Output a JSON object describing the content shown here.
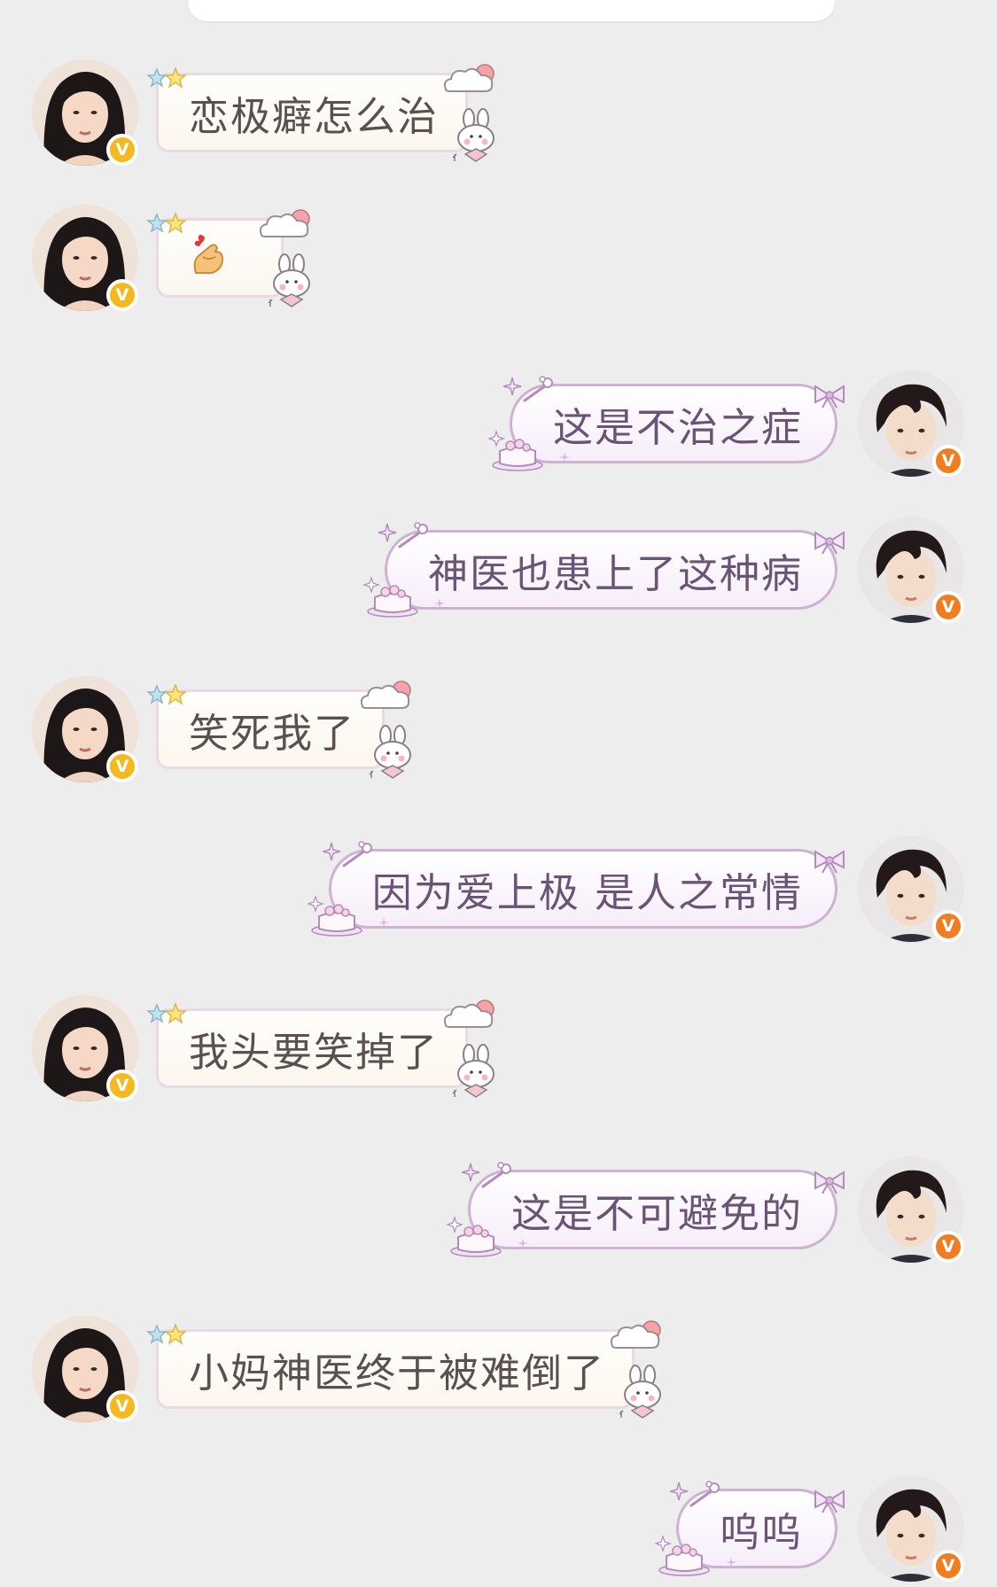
{
  "colors": {
    "background": "#ededed",
    "badge_left": "#f5b81f",
    "badge_right": "#f07e21",
    "bubble_left_border": "#ead9e6",
    "bubble_right_border": "#cfb1d4"
  },
  "icons": {
    "verified_badge": "V"
  },
  "messages": [
    {
      "side": "left",
      "text": "恋极癖怎么治"
    },
    {
      "side": "left",
      "text": "🫰",
      "emoji": true
    },
    {
      "side": "right",
      "text": "这是不治之症"
    },
    {
      "side": "right",
      "text": "神医也患上了这种病"
    },
    {
      "side": "left",
      "text": "笑死我了"
    },
    {
      "side": "right",
      "text": "因为爱上极 是人之常情"
    },
    {
      "side": "left",
      "text": "我头要笑掉了"
    },
    {
      "side": "right",
      "text": "这是不可避免的"
    },
    {
      "side": "left",
      "text": "小妈神医终于被难倒了"
    },
    {
      "side": "right",
      "text": "呜呜"
    }
  ]
}
